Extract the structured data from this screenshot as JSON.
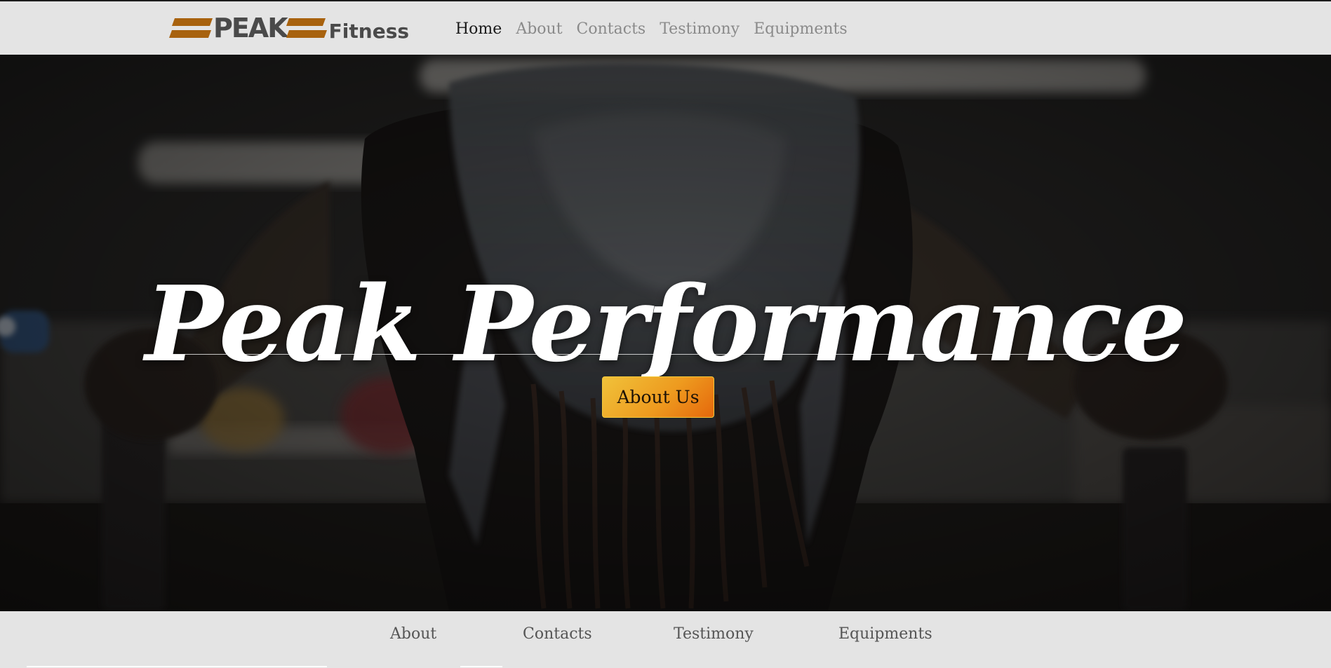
{
  "brand": {
    "name_main": "PEAK",
    "name_sub": "Fitness",
    "accent_color": "#a8620e",
    "text_color": "#4a4a4a"
  },
  "nav": {
    "items": [
      {
        "label": "Home",
        "active": true
      },
      {
        "label": "About",
        "active": false
      },
      {
        "label": "Contacts",
        "active": false
      },
      {
        "label": "Testimony",
        "active": false
      },
      {
        "label": "Equipments",
        "active": false
      }
    ]
  },
  "hero": {
    "title": "Peak Performance",
    "button_label": "About Us",
    "button_gradient": [
      "#f0c23a",
      "#ee9b1f",
      "#e5680c"
    ]
  },
  "footer_nav": {
    "items": [
      {
        "label": "About"
      },
      {
        "label": "Contacts"
      },
      {
        "label": "Testimony"
      },
      {
        "label": "Equipments"
      }
    ]
  }
}
